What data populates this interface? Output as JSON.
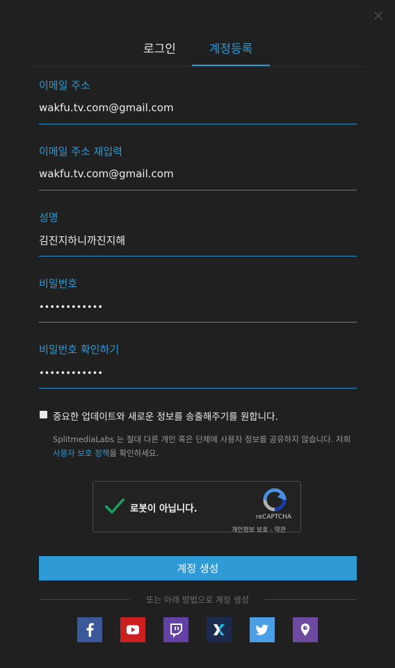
{
  "close_glyph": "×",
  "tabs": {
    "login": "로그인",
    "register": "계정등록"
  },
  "fields": {
    "email": {
      "label": "이메일 주소",
      "value": "wakfu.tv.com@gmail.com"
    },
    "email_confirm": {
      "label": "이메일 주소 재입력",
      "value": "wakfu.tv.com@gmail.com"
    },
    "name": {
      "label": "성명",
      "value": "김진지하니까진지해"
    },
    "password": {
      "label": "비밀번호",
      "value": "••••••••••••"
    },
    "password_confirm": {
      "label": "비밀번호 확인하기",
      "value": "••••••••••••"
    }
  },
  "newsletter": {
    "label": "중요한 업데이트와 새로운 정보를 송출해주기를 원합니다.",
    "checked": false
  },
  "notice": {
    "text_before": "SplitmediaLabs 는 절대 다른 개인 혹은 단체에 사용자 정보를 공유하지 않습니다. 저희 ",
    "link": "사용자 보호 정책",
    "text_after": "을 확인하세요."
  },
  "captcha": {
    "label": "로봇이 아닙니다.",
    "brand": "reCAPTCHA",
    "links": "개인정보 보호 - 약관",
    "checked": true
  },
  "submit_label": "계정 생성",
  "divider_text": "또는 아래 방법으로 계정 생성",
  "social": [
    {
      "icon": "facebook-icon",
      "color": "#3b5998"
    },
    {
      "icon": "youtube-icon",
      "color": "#cc2020"
    },
    {
      "icon": "twitch-icon",
      "color": "#6441a4"
    },
    {
      "icon": "mixer-icon",
      "color": "#1b2a4e"
    },
    {
      "icon": "twitter-icon",
      "color": "#4a9fe6"
    },
    {
      "icon": "periscope-icon",
      "color": "#6e49a0"
    }
  ],
  "colors": {
    "accent": "#2e9ad6",
    "background": "#202020"
  }
}
